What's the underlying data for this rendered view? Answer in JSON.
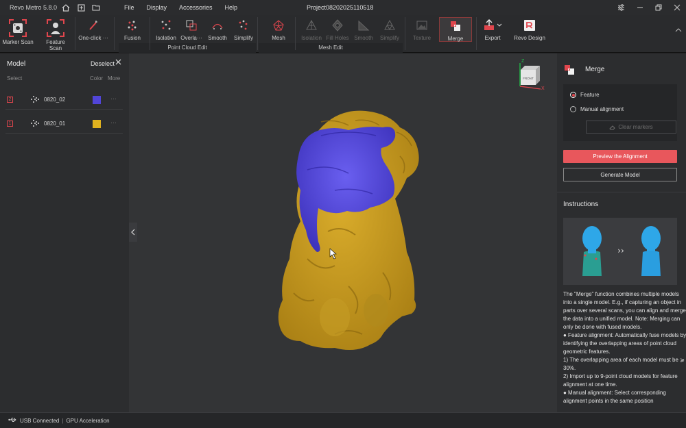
{
  "titlebar": {
    "app_name": "Revo Metro 5.8.0",
    "menu": [
      "File",
      "Display",
      "Accessories",
      "Help"
    ],
    "project": "Project08202025110518"
  },
  "ribbon": {
    "tools": {
      "marker_scan": "Marker Scan",
      "feature_scan": "Feature Scan",
      "one_click": "One-click ···",
      "fusion": "Fusion",
      "pc_isolation": "Isolation",
      "pc_overlap": "Overla···",
      "pc_smooth": "Smooth",
      "pc_simplify": "Simplify",
      "mesh": "Mesh",
      "mesh_isolation": "Isolation",
      "mesh_fill_holes": "Fill Holes",
      "mesh_smooth": "Smooth",
      "mesh_simplify": "Simplify",
      "texture": "Texture",
      "merge": "Merge",
      "export": "Export",
      "revo_design": "Revo Design"
    },
    "groups": {
      "point_cloud_edit": "Point Cloud Edit",
      "mesh_edit": "Mesh Edit"
    }
  },
  "left_panel": {
    "title": "Model",
    "deselect": "Deselect",
    "col_select": "Select",
    "col_color": "Color",
    "col_more": "More",
    "models": [
      {
        "num": "2",
        "name": "0820_02",
        "color": "#5145d8"
      },
      {
        "num": "1",
        "name": "0820_01",
        "color": "#e0b21f"
      }
    ]
  },
  "viewcube": {
    "face": "FRONT",
    "axis_x": "X",
    "axis_z": "Z"
  },
  "right_panel": {
    "title": "Merge",
    "options": [
      "Feature",
      "Manual alignment"
    ],
    "selected_option": "Feature",
    "clear_markers": "Clear markers",
    "preview_button": "Preview the Alignment",
    "generate_button": "Generate Model",
    "instructions_title": "Instructions",
    "image_arrow": "››",
    "instructions": [
      "The \"Merge\" function combines multiple models into a single model. E.g., if capturing an object in parts over several scans, you can align and merge the data into a unified model. Note: Merging can only be done with fused models.",
      "● Feature alignment: Automatically fuse models by identifying the overlapping areas of point cloud geometric features.",
      "1) The overlapping area of each model must be ⩾ 30%.",
      "2) Import up to 9-point cloud models for feature alignment at one time.",
      "● Manual alignment: Select corresponding alignment points in the same position"
    ]
  },
  "statusbar": {
    "usb": "USB Connected",
    "separator": "|",
    "gpu": "GPU Acceleration"
  },
  "colors": {
    "accent": "#e8575c",
    "model_blue": "#5145d8",
    "model_yellow": "#d4a724"
  }
}
